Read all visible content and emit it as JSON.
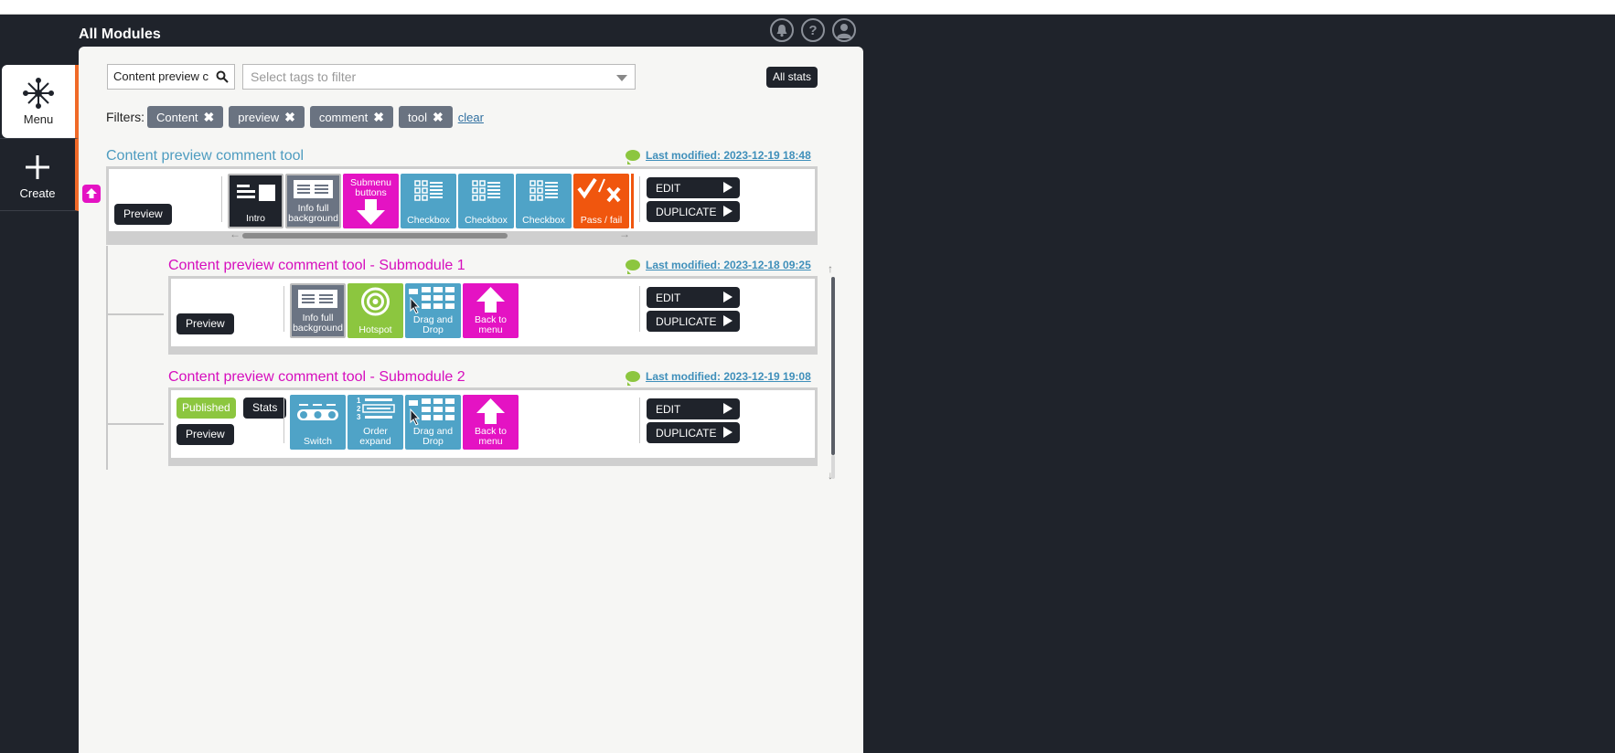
{
  "header": {
    "title": "All Modules"
  },
  "sidebar": {
    "menu_label": "Menu",
    "create_label": "Create"
  },
  "search": {
    "value": "Content preview c"
  },
  "tags_select": {
    "placeholder": "Select tags to filter"
  },
  "all_stats_label": "All stats",
  "filters": {
    "label": "Filters:",
    "chips": [
      "Content",
      "preview",
      "comment",
      "tool"
    ],
    "clear_label": "clear"
  },
  "modules": [
    {
      "title": "Content preview comment tool",
      "last_modified": "Last modified: 2023-12-19 18:48",
      "preview_label": "Preview",
      "edit_label": "EDIT",
      "duplicate_label": "DUPLICATE",
      "tiles": [
        "Intro",
        "Info full background",
        "Submenu buttons",
        "Checkbox",
        "Checkbox",
        "Checkbox",
        "Pass / fail"
      ]
    },
    {
      "title": "Content preview comment tool - Submodule 1",
      "last_modified": "Last modified: 2023-12-18 09:25",
      "preview_label": "Preview",
      "edit_label": "EDIT",
      "duplicate_label": "DUPLICATE",
      "tiles": [
        "Info full background",
        "Hotspot",
        "Drag and Drop",
        "Back to menu"
      ]
    },
    {
      "title": "Content preview comment tool - Submodule 2",
      "last_modified": "Last modified: 2023-12-19 19:08",
      "published_label": "Published",
      "stats_label": "Stats",
      "preview_label": "Preview",
      "edit_label": "EDIT",
      "duplicate_label": "DUPLICATE",
      "tiles": [
        "Switch",
        "Order expand",
        "Drag and Drop",
        "Back to menu"
      ]
    }
  ],
  "colors": {
    "accent_orange": "#f06a28",
    "pink": "#e413c3",
    "blue_tile": "#4fa3c7",
    "green": "#8cc63f",
    "dark": "#1f232b"
  }
}
